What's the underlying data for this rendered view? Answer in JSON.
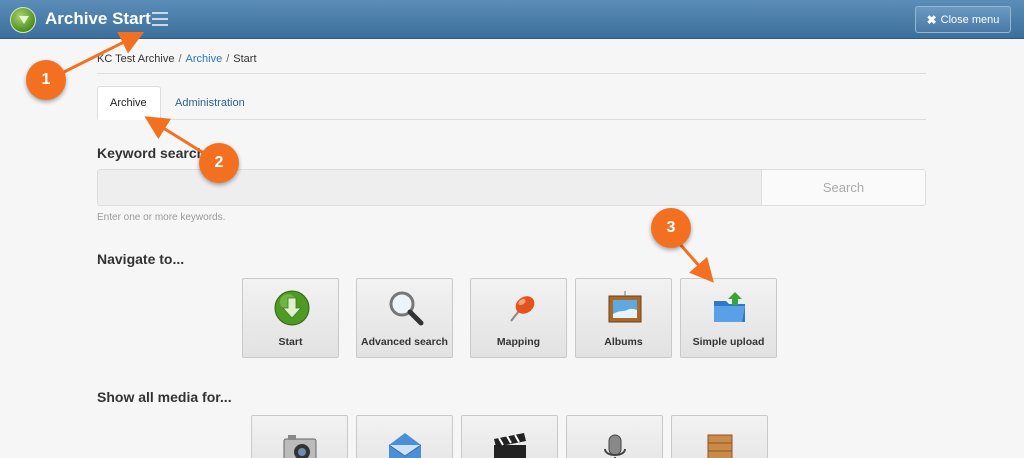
{
  "header": {
    "title": "Archive Start",
    "close_label": "Close menu"
  },
  "breadcrumb": {
    "items": [
      "KC Test Archive",
      "Archive",
      "Start"
    ]
  },
  "tabs": [
    "Archive",
    "Administration"
  ],
  "search": {
    "title": "Keyword search",
    "placeholder": "",
    "button_label": "Search",
    "hint": "Enter one or more keywords."
  },
  "navigate": {
    "title": "Navigate to...",
    "items": [
      {
        "label": "Start",
        "icon": "start-down-arrow-icon"
      },
      {
        "label": "Advanced search",
        "icon": "magnifier-icon"
      },
      {
        "label": "Mapping",
        "icon": "pushpin-icon"
      },
      {
        "label": "Albums",
        "icon": "framed-picture-icon"
      },
      {
        "label": "Simple upload",
        "icon": "folder-upload-icon"
      }
    ]
  },
  "media": {
    "title": "Show all media for...",
    "items": [
      {
        "icon": "camera-icon"
      },
      {
        "icon": "envelope-icon"
      },
      {
        "icon": "clapperboard-icon"
      },
      {
        "icon": "microphone-icon"
      },
      {
        "icon": "box-icon"
      }
    ]
  },
  "callouts": [
    "1",
    "2",
    "3"
  ],
  "colors": {
    "header": "#4a7aa5",
    "link": "#2b77c3",
    "callout": "#f37021"
  }
}
